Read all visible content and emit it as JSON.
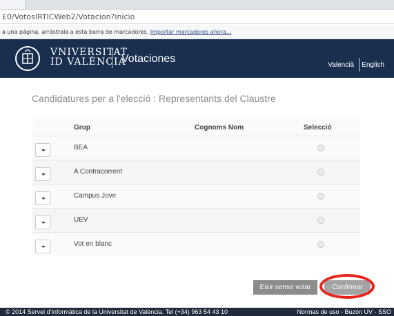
{
  "browser": {
    "url": "£0/VotosIRTICWeb2/Votacion?inicio",
    "bookmarks_text": "a una página, arrástrala a esta barra de marcadores.",
    "bookmarks_link": "Importar marcadores ahora..."
  },
  "header": {
    "logo_line1": "VNIVERSITAT",
    "logo_line2": "ID VALÈNCIA",
    "app_title": "Votaciones",
    "lang_valencia": "Valencià",
    "lang_english": "English"
  },
  "page": {
    "heading": "Candidatures per a l'elecció : Representants del Claustre"
  },
  "table": {
    "columns": [
      "Grup",
      "Cognoms Nom",
      "Selecció"
    ],
    "rows": [
      {
        "grup": "BEA"
      },
      {
        "grup": "A Contracorrent"
      },
      {
        "grup": "Campus Jove"
      },
      {
        "grup": "UEV"
      },
      {
        "grup": "Vot en blanc"
      }
    ]
  },
  "actions": {
    "exit_label": "Eixir sense votar",
    "confirm_label": "Confirmar"
  },
  "footer": {
    "left": "© 2014 Servei d'Informàtica de la Universitat de València. Tel (+34) 963 54 43 10",
    "right": "Normas de uso - Buzón UV - SSO"
  },
  "colors": {
    "header_bg": "#1a2f4f",
    "annotation": "#e8231b"
  }
}
